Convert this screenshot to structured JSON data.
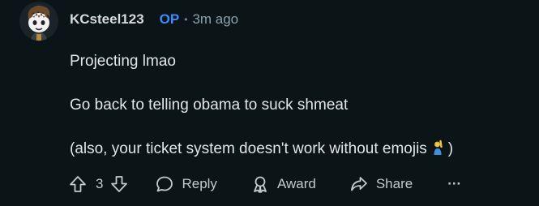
{
  "comment": {
    "username": "KCsteel123",
    "op_badge": "OP",
    "separator": "•",
    "timestamp": "3m ago",
    "paragraphs": [
      "Projecting lmao",
      "Go back to telling obama to suck shmeat",
      "(also, your ticket system doesn't work without emojis",
      ")"
    ],
    "emoji_icon": "person-raising-hand-emoji"
  },
  "actions": {
    "upvote_icon": "arrow-up-icon",
    "vote_count": "3",
    "downvote_icon": "arrow-down-icon",
    "reply_label": "Reply",
    "reply_icon": "speech-bubble-icon",
    "award_label": "Award",
    "award_icon": "award-ribbon-icon",
    "share_label": "Share",
    "share_icon": "share-arrow-icon",
    "more_label": "···"
  },
  "colors": {
    "background": "#0b1416",
    "op_accent": "#3d8bfd",
    "meta_text": "#8ba2ad",
    "body_text": "#e3e6e8"
  }
}
